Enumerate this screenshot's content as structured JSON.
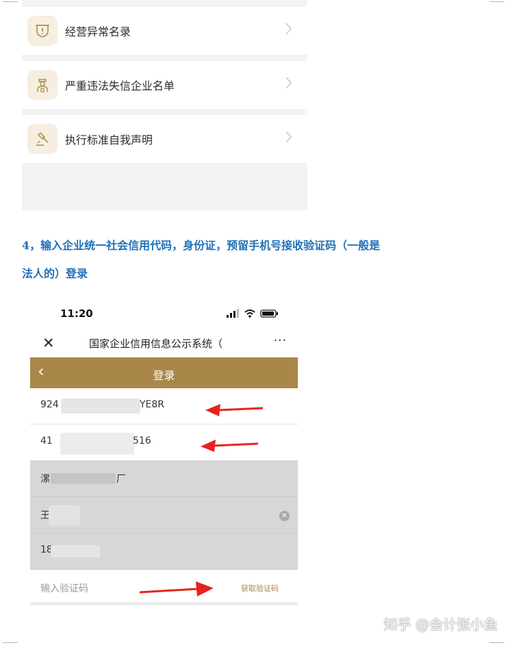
{
  "menu": {
    "items": [
      {
        "label": "经营异常名录",
        "icon": "shield-alert-icon"
      },
      {
        "label": "严重违法失信企业名单",
        "icon": "person-badge-icon"
      },
      {
        "label": "执行标准自我声明",
        "icon": "gavel-icon"
      }
    ]
  },
  "instructions": {
    "line1": "4，输入企业统一社会信用代码，身份证，预留手机号接收验证码（一般是",
    "line2": "法人的）登录"
  },
  "phone": {
    "status": {
      "time": "11:20"
    },
    "navbar": {
      "title": "国家企业信用信息公示系统（",
      "more": "···",
      "close": "✕"
    },
    "login_title": "登录",
    "fields": {
      "credit_code_prefix": "924",
      "credit_code_suffix": "YE8R",
      "id_prefix": "41",
      "id_suffix": "516",
      "company_prefix": "漯",
      "company_suffix": "厂",
      "name_prefix": "王",
      "phone_prefix": "18"
    },
    "verification": {
      "placeholder": "输入验证码",
      "get_code": "获取验证码"
    }
  },
  "colors": {
    "accent": "#a88748",
    "heading": "#1f70b8",
    "arrow": "#e8231c"
  },
  "watermark": "知乎 @会计张小鱼"
}
